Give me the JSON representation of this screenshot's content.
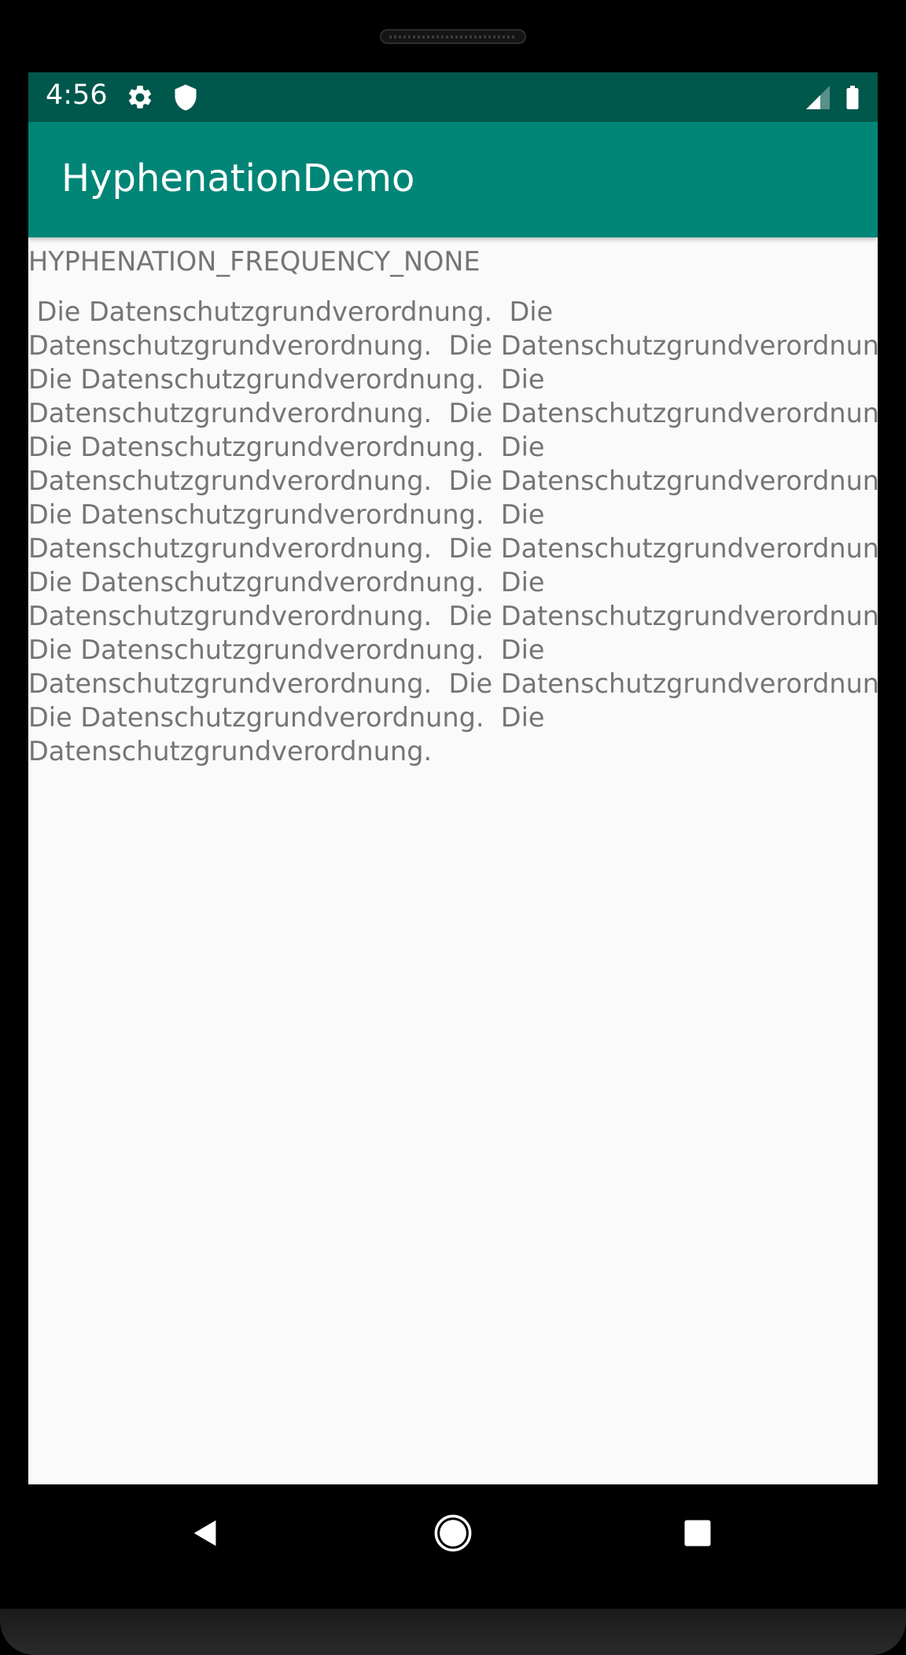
{
  "status_bar": {
    "time": "4:56",
    "icons": [
      "settings-gear-icon",
      "shield-icon",
      "cellular-signal-icon",
      "battery-icon"
    ]
  },
  "app_bar": {
    "title": "HyphenationDemo"
  },
  "content": {
    "label": "HYPHENATION_FREQUENCY_NONE",
    "lines": [
      " Die Datenschutzgrundverordnung.  Die",
      "Datenschutzgrundverordnung.  Die Datenschutzgrundverordnung.",
      "Die Datenschutzgrundverordnung.  Die",
      "Datenschutzgrundverordnung.  Die Datenschutzgrundverordnung.",
      "Die Datenschutzgrundverordnung.  Die",
      "Datenschutzgrundverordnung.  Die Datenschutzgrundverordnung.",
      "Die Datenschutzgrundverordnung.  Die",
      "Datenschutzgrundverordnung.  Die Datenschutzgrundverordnung.",
      "Die Datenschutzgrundverordnung.  Die",
      "Datenschutzgrundverordnung.  Die Datenschutzgrundverordnung.",
      "Die Datenschutzgrundverordnung.  Die",
      "Datenschutzgrundverordnung.  Die Datenschutzgrundverordnung.",
      "Die Datenschutzgrundverordnung.  Die",
      "Datenschutzgrundverordnung."
    ]
  },
  "nav_bar": {
    "icons": [
      "back-icon",
      "home-icon",
      "recents-icon"
    ]
  },
  "colors": {
    "status_bar": "#00574b",
    "app_bar": "#008577",
    "background": "#fafafa",
    "text": "#757575"
  }
}
